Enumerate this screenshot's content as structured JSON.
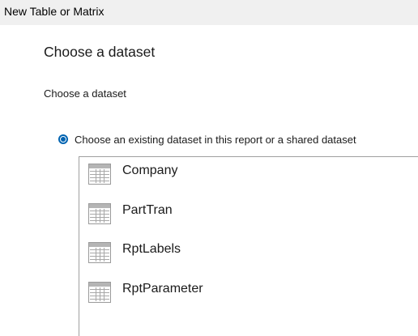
{
  "window": {
    "title": "New Table or Matrix"
  },
  "main": {
    "heading": "Choose a dataset",
    "section_label": "Choose a dataset",
    "option": {
      "label": "Choose an existing dataset in this report or a shared dataset",
      "selected": true
    },
    "datasets": [
      {
        "label": "Company",
        "icon": "table-icon"
      },
      {
        "label": "PartTran",
        "icon": "table-icon"
      },
      {
        "label": "RptLabels",
        "icon": "table-icon"
      },
      {
        "label": "RptParameter",
        "icon": "table-icon"
      }
    ]
  },
  "colors": {
    "accent": "#0063b1",
    "titlebar": "#f0f0f0",
    "border": "#a0a0a0"
  }
}
